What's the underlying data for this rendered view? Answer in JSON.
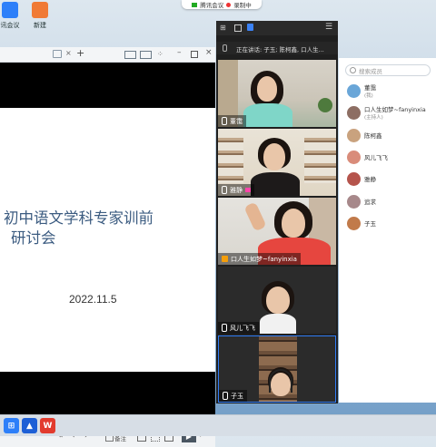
{
  "desktop": {
    "icons": [
      {
        "label": "讯会议"
      },
      {
        "label": "新建"
      }
    ]
  },
  "meeting_status": {
    "app": "腾讯会议",
    "recording": "录制中"
  },
  "ppt_window": {
    "slide": {
      "title_line1": "初中语文学科专家训前",
      "title_line2": "研讨会",
      "date": "2022.11.5"
    },
    "status_bar": {
      "notes_label": "备注"
    }
  },
  "video_panel": {
    "speaking_text": "正在讲话: 子玉; 陈柯鑫, 口人生...",
    "tiles": [
      {
        "name": "董霭"
      },
      {
        "name": "雅静"
      },
      {
        "name": "口人生如梦~fanyinxia"
      },
      {
        "name": "风儿飞飞"
      },
      {
        "name": "子玉"
      }
    ]
  },
  "participants": {
    "search_placeholder": "搜索成员",
    "list": [
      {
        "name": "董霭",
        "role": "(我)",
        "color": "#6aa6d8"
      },
      {
        "name": "口人生如梦~fanyinxia",
        "role": "(主持人)",
        "color": "#8d6e63"
      },
      {
        "name": "陈柯鑫",
        "role": "",
        "color": "#c9a27e"
      },
      {
        "name": "风儿飞飞",
        "role": "",
        "color": "#d98c7a"
      },
      {
        "name": "雅静",
        "role": "",
        "color": "#b5544c"
      },
      {
        "name": "追求",
        "role": "",
        "color": "#a7888a"
      },
      {
        "name": "子玉",
        "role": "",
        "color": "#c17a4a"
      }
    ]
  },
  "taskbar": {
    "wps_label": "W"
  }
}
